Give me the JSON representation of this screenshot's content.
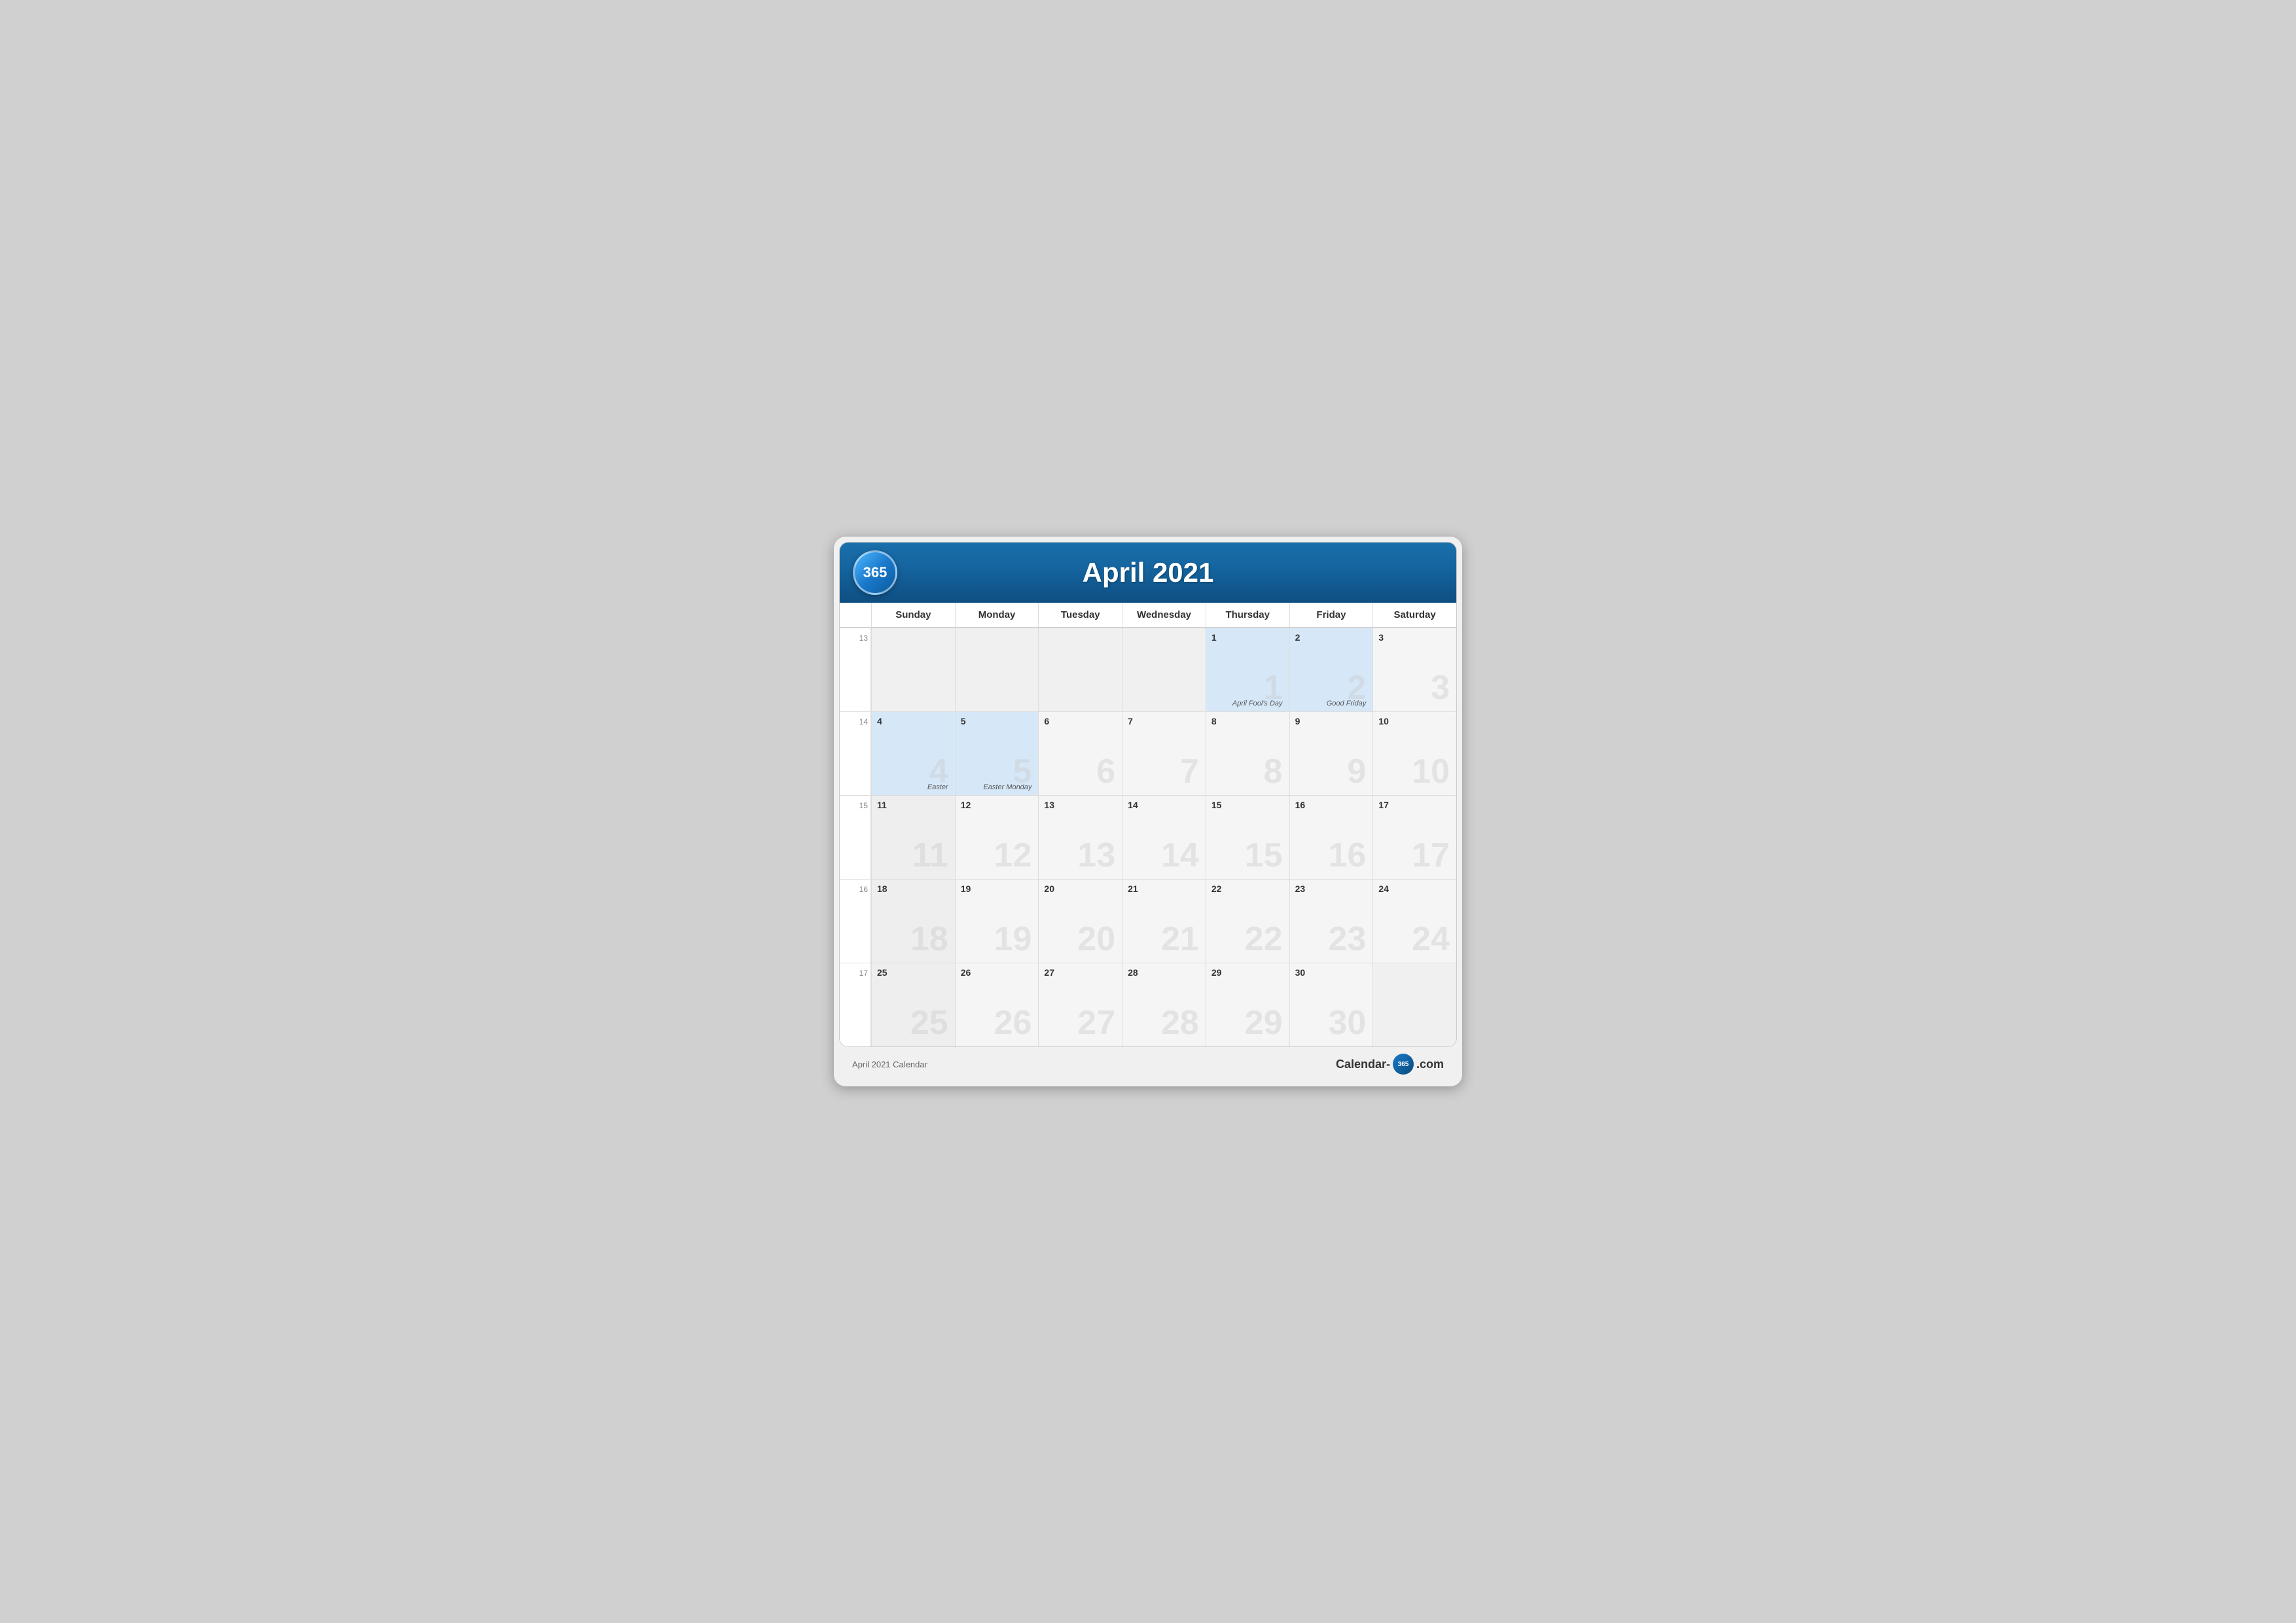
{
  "header": {
    "logo": "365",
    "title": "April 2021"
  },
  "days_of_week": [
    "Sunday",
    "Monday",
    "Tuesday",
    "Wednesday",
    "Thursday",
    "Friday",
    "Saturday"
  ],
  "weeks": [
    {
      "week_number": "13",
      "days": [
        {
          "date": "",
          "type": "empty",
          "watermark": ""
        },
        {
          "date": "",
          "type": "empty",
          "watermark": ""
        },
        {
          "date": "",
          "type": "empty",
          "watermark": ""
        },
        {
          "date": "",
          "type": "empty",
          "watermark": ""
        },
        {
          "date": "1",
          "type": "highlight",
          "watermark": "1",
          "holiday": "April Fool's Day"
        },
        {
          "date": "2",
          "type": "highlight",
          "watermark": "2",
          "holiday": "Good Friday"
        },
        {
          "date": "3",
          "type": "normal",
          "watermark": "3"
        }
      ]
    },
    {
      "week_number": "14",
      "days": [
        {
          "date": "4",
          "type": "highlight sunday",
          "watermark": "4",
          "holiday": "Easter"
        },
        {
          "date": "5",
          "type": "highlight",
          "watermark": "5",
          "holiday": "Easter Monday"
        },
        {
          "date": "6",
          "type": "normal",
          "watermark": "6"
        },
        {
          "date": "7",
          "type": "normal",
          "watermark": "7"
        },
        {
          "date": "8",
          "type": "normal",
          "watermark": "8"
        },
        {
          "date": "9",
          "type": "normal",
          "watermark": "9"
        },
        {
          "date": "10",
          "type": "normal",
          "watermark": "10"
        }
      ]
    },
    {
      "week_number": "15",
      "days": [
        {
          "date": "11",
          "type": "sunday",
          "watermark": "11"
        },
        {
          "date": "12",
          "type": "normal",
          "watermark": "12"
        },
        {
          "date": "13",
          "type": "normal",
          "watermark": "13"
        },
        {
          "date": "14",
          "type": "normal",
          "watermark": "14"
        },
        {
          "date": "15",
          "type": "normal",
          "watermark": "15"
        },
        {
          "date": "16",
          "type": "normal",
          "watermark": "16"
        },
        {
          "date": "17",
          "type": "normal",
          "watermark": "17"
        }
      ]
    },
    {
      "week_number": "16",
      "days": [
        {
          "date": "18",
          "type": "sunday",
          "watermark": "18"
        },
        {
          "date": "19",
          "type": "normal",
          "watermark": "19"
        },
        {
          "date": "20",
          "type": "normal",
          "watermark": "20"
        },
        {
          "date": "21",
          "type": "normal",
          "watermark": "21"
        },
        {
          "date": "22",
          "type": "normal",
          "watermark": "22"
        },
        {
          "date": "23",
          "type": "normal",
          "watermark": "23"
        },
        {
          "date": "24",
          "type": "normal",
          "watermark": "24"
        }
      ]
    },
    {
      "week_number": "17",
      "days": [
        {
          "date": "25",
          "type": "sunday",
          "watermark": "25"
        },
        {
          "date": "26",
          "type": "normal",
          "watermark": "26"
        },
        {
          "date": "27",
          "type": "normal",
          "watermark": "27"
        },
        {
          "date": "28",
          "type": "normal",
          "watermark": "28"
        },
        {
          "date": "29",
          "type": "normal",
          "watermark": "29"
        },
        {
          "date": "30",
          "type": "normal",
          "watermark": "30"
        },
        {
          "date": "",
          "type": "empty",
          "watermark": ""
        }
      ]
    }
  ],
  "footer": {
    "caption": "April 2021 Calendar",
    "brand_text_before": "Calendar-",
    "brand_365": "365",
    "brand_text_after": ".com"
  }
}
